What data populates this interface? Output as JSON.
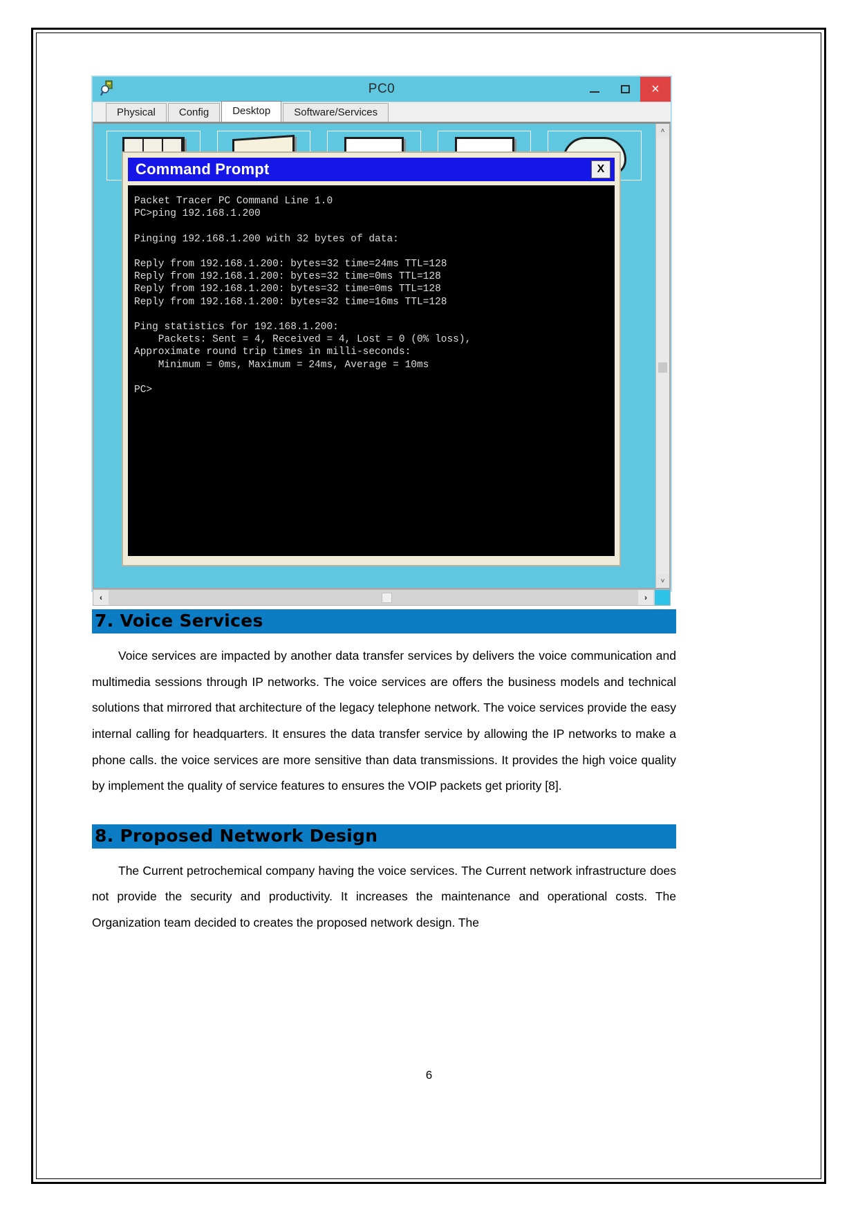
{
  "window": {
    "title": "PC0",
    "app_icon": "packet-tracer-icon",
    "buttons": {
      "minimize": "–",
      "maximize": "□",
      "close": "×"
    },
    "tabs": [
      {
        "label": "Physical",
        "active": false
      },
      {
        "label": "Config",
        "active": false
      },
      {
        "label": "Desktop",
        "active": true
      },
      {
        "label": "Software/Services",
        "active": false
      }
    ],
    "scroll": {
      "up_arrow": "˄",
      "down_arrow": "˅",
      "left_arrow": "‹",
      "right_arrow": "›"
    }
  },
  "command_prompt": {
    "title": "Command Prompt",
    "close_label": "X",
    "output": "Packet Tracer PC Command Line 1.0\nPC>ping 192.168.1.200\n\nPinging 192.168.1.200 with 32 bytes of data:\n\nReply from 192.168.1.200: bytes=32 time=24ms TTL=128\nReply from 192.168.1.200: bytes=32 time=0ms TTL=128\nReply from 192.168.1.200: bytes=32 time=0ms TTL=128\nReply from 192.168.1.200: bytes=32 time=16ms TTL=128\n\nPing statistics for 192.168.1.200:\n    Packets: Sent = 4, Received = 4, Lost = 0 (0% loss),\nApproximate round trip times in milli-seconds:\n    Minimum = 0ms, Maximum = 24ms, Average = 10ms\n\nPC>"
  },
  "document": {
    "sections": [
      {
        "heading": "7. Voice Services",
        "body": "Voice services are impacted by another data transfer services by delivers the voice communication and multimedia sessions through IP networks. The voice services are offers the business models and technical solutions that mirrored that architecture of the legacy telephone network. The voice services provide the easy internal calling for headquarters. It ensures the data transfer service by allowing the IP networks to make a phone calls. the voice services are more sensitive than data transmissions. It provides the high voice quality by implement the quality of service features to ensures the VOIP packets get priority [8]."
      },
      {
        "heading": "8. Proposed Network Design",
        "body": "The Current petrochemical company having the voice services. The Current network infrastructure does not provide the security and productivity. It increases the maintenance and operational costs. The Organization team decided to creates the proposed network design. The"
      }
    ],
    "page_number": "6"
  },
  "colors": {
    "heading_band": "#0c7cc4",
    "pt_titlebar": "#5fc8e0",
    "cmd_titlebar": "#1616e8",
    "close_button": "#e04343",
    "terminal_bg": "#000000",
    "terminal_fg": "#dcdcdc"
  }
}
